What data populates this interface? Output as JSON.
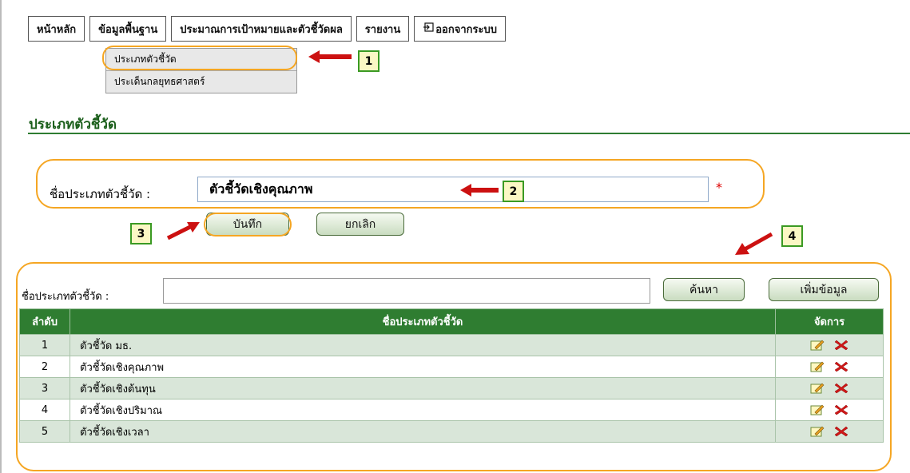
{
  "menu": {
    "items": [
      "หน้าหลัก",
      "ข้อมูลพื้นฐาน",
      "ประมาณการเป้าหมายและตัวชี้วัดผล",
      "รายงาน",
      "ออกจากระบบ"
    ],
    "submenu": [
      "ประเภทตัวชี้วัด",
      "ประเด็นกลยุทธศาสตร์"
    ]
  },
  "page": {
    "title": "ประเภทตัวชี้วัด"
  },
  "form": {
    "label": "ชื่อประเภทตัวชี้วัด :",
    "value": "ตัวชี้วัดเชิงคุณภาพ",
    "required_mark": "*",
    "save_label": "บันทึก",
    "cancel_label": "ยกเลิก"
  },
  "search": {
    "label": "ชื่อประเภทตัวชี้วัด :",
    "value": "",
    "search_label": "ค้นหา",
    "add_label": "เพิ่มข้อมูล"
  },
  "table": {
    "headers": [
      "ลำดับ",
      "ชื่อประเภทตัวชี้วัด",
      "จัดการ"
    ],
    "rows": [
      {
        "seq": "1",
        "name": "ตัวชี้วัด มธ."
      },
      {
        "seq": "2",
        "name": "ตัวชี้วัดเชิงคุณภาพ"
      },
      {
        "seq": "3",
        "name": "ตัวชี้วัดเชิงต้นทุน"
      },
      {
        "seq": "4",
        "name": "ตัวชี้วัดเชิงปริมาณ"
      },
      {
        "seq": "5",
        "name": "ตัวชี้วัดเชิงเวลา"
      }
    ]
  },
  "annotations": [
    "1",
    "2",
    "3",
    "4"
  ],
  "icons": {
    "exit": "exit-icon",
    "edit": "edit-icon",
    "delete": "delete-icon",
    "arrow": "red-arrow-icon"
  },
  "colors": {
    "header_green": "#2f7d31",
    "accent_orange": "#f5a623",
    "arrow_red": "#cc1111"
  }
}
